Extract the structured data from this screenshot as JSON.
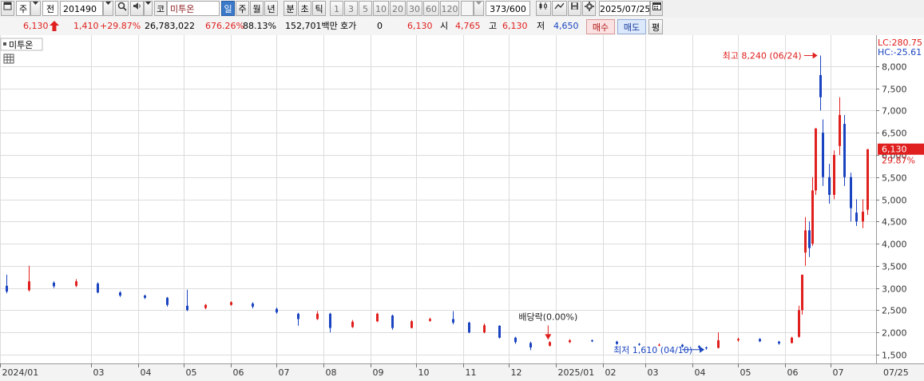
{
  "toolbar": {
    "market_label": "주",
    "prev_label": "전",
    "stock_code": "201490",
    "market_badge": "코",
    "stock_name": "미투온",
    "periods": [
      "일",
      "주",
      "월",
      "년",
      "분",
      "초",
      "틱"
    ],
    "active_period": "일",
    "intervals": [
      "1",
      "3",
      "5",
      "10",
      "20",
      "30",
      "60",
      "120"
    ],
    "count": "373/600",
    "date": "2025/07/25"
  },
  "quote": {
    "price": "6,130",
    "change": "1,410",
    "change_pct": "+29.87%",
    "volume": "26,783,022",
    "volume_ratio": "676.26%",
    "turnover": "88.13%",
    "amount": "152,701백만",
    "hoga_label": "호가",
    "hoga_value": "0",
    "hoga_price": "6,130",
    "open_label": "시",
    "open": "4,765",
    "high_label": "고",
    "high": "6,130",
    "low_label": "저",
    "low": "4,650",
    "buy_label": "매수",
    "sell_label": "매도",
    "flat_label": "평"
  },
  "colors": {
    "up": "#e0201e",
    "down": "#1a44c0",
    "grid": "#dcdcdc",
    "current_price_bg": "#e0201e"
  },
  "chart_data": {
    "type": "candlestick",
    "series_label": "미투온",
    "right_labels": {
      "lc": "LC:280.75",
      "hc": "HC:-25.61"
    },
    "current_price_label": "6,130",
    "current_pct_label": "29.87%",
    "ylim": [
      1300,
      8700
    ],
    "y_ticks": [
      1500,
      2000,
      2500,
      3000,
      3500,
      4000,
      4500,
      5000,
      5500,
      6000,
      6500,
      7000,
      7500,
      8000
    ],
    "y_tick_labels": [
      "1,500",
      "2,000",
      "2,500",
      "3,000",
      "3,500",
      "4,000",
      "4,500",
      "5,000",
      "5,500",
      "6,000",
      "6,500",
      "7,000",
      "7,500",
      "8,000"
    ],
    "x_range": [
      "2024-01-01",
      "2025-07-31"
    ],
    "x_ticks": [
      {
        "date": "2024-01-01",
        "label": "2024/01"
      },
      {
        "date": "2024-03-01",
        "label": "03"
      },
      {
        "date": "2024-04-01",
        "label": "04"
      },
      {
        "date": "2024-05-01",
        "label": "05"
      },
      {
        "date": "2024-06-01",
        "label": "06"
      },
      {
        "date": "2024-07-01",
        "label": "07"
      },
      {
        "date": "2024-08-01",
        "label": "08"
      },
      {
        "date": "2024-09-01",
        "label": "09"
      },
      {
        "date": "2024-10-01",
        "label": "10"
      },
      {
        "date": "2024-11-01",
        "label": "11"
      },
      {
        "date": "2024-12-01",
        "label": "12"
      },
      {
        "date": "2025-01-01",
        "label": "2025/01"
      },
      {
        "date": "2025-02-01",
        "label": "02"
      },
      {
        "date": "2025-03-01",
        "label": "03"
      },
      {
        "date": "2025-04-01",
        "label": "04"
      },
      {
        "date": "2025-05-01",
        "label": "05"
      },
      {
        "date": "2025-06-01",
        "label": "06"
      },
      {
        "date": "2025-07-01",
        "label": "07"
      }
    ],
    "last_date_label": "07/25",
    "annotations": [
      {
        "date": "2025-06-24",
        "price": 8240,
        "text": "최고 8,240 (06/24)",
        "kind": "high"
      },
      {
        "date": "2025-04-10",
        "price": 1610,
        "text": "최저 1,610 (04/10)",
        "kind": "low"
      },
      {
        "date": "2024-12-27",
        "price": 1780,
        "text": "배당락(0.00%)",
        "kind": "dividend"
      }
    ],
    "candles": [
      {
        "date": "2024-01-05",
        "open": 3050,
        "close": 2920,
        "high": 3300,
        "low": 2880
      },
      {
        "date": "2024-01-20",
        "open": 2950,
        "close": 3150,
        "high": 3500,
        "low": 2920
      },
      {
        "date": "2024-02-05",
        "open": 3120,
        "close": 3040,
        "high": 3150,
        "low": 3000
      },
      {
        "date": "2024-02-20",
        "open": 3050,
        "close": 3150,
        "high": 3200,
        "low": 3020
      },
      {
        "date": "2024-03-05",
        "open": 3100,
        "close": 2900,
        "high": 3130,
        "low": 2880
      },
      {
        "date": "2024-03-20",
        "open": 2900,
        "close": 2830,
        "high": 2930,
        "low": 2800
      },
      {
        "date": "2024-04-05",
        "open": 2830,
        "close": 2780,
        "high": 2850,
        "low": 2750
      },
      {
        "date": "2024-04-20",
        "open": 2780,
        "close": 2620,
        "high": 2800,
        "low": 2580
      },
      {
        "date": "2024-05-03",
        "open": 2600,
        "close": 2500,
        "high": 2960,
        "low": 2480
      },
      {
        "date": "2024-05-15",
        "open": 2550,
        "close": 2620,
        "high": 2640,
        "low": 2520
      },
      {
        "date": "2024-06-01",
        "open": 2620,
        "close": 2680,
        "high": 2700,
        "low": 2600
      },
      {
        "date": "2024-06-15",
        "open": 2650,
        "close": 2580,
        "high": 2680,
        "low": 2540
      },
      {
        "date": "2024-07-01",
        "open": 2530,
        "close": 2450,
        "high": 2560,
        "low": 2420
      },
      {
        "date": "2024-07-15",
        "open": 2420,
        "close": 2300,
        "high": 2440,
        "low": 2150
      },
      {
        "date": "2024-07-28",
        "open": 2300,
        "close": 2420,
        "high": 2480,
        "low": 2280
      },
      {
        "date": "2024-08-05",
        "open": 2420,
        "close": 2100,
        "high": 2440,
        "low": 2000
      },
      {
        "date": "2024-08-20",
        "open": 2120,
        "close": 2240,
        "high": 2280,
        "low": 2100
      },
      {
        "date": "2024-09-05",
        "open": 2250,
        "close": 2420,
        "high": 2440,
        "low": 2230
      },
      {
        "date": "2024-09-15",
        "open": 2380,
        "close": 2100,
        "high": 2400,
        "low": 2060
      },
      {
        "date": "2024-09-28",
        "open": 2100,
        "close": 2250,
        "high": 2280,
        "low": 2090
      },
      {
        "date": "2024-10-10",
        "open": 2260,
        "close": 2300,
        "high": 2330,
        "low": 2240
      },
      {
        "date": "2024-10-25",
        "open": 2300,
        "close": 2220,
        "high": 2480,
        "low": 2180
      },
      {
        "date": "2024-11-05",
        "open": 2220,
        "close": 2000,
        "high": 2240,
        "low": 1980
      },
      {
        "date": "2024-11-15",
        "open": 2000,
        "close": 2160,
        "high": 2200,
        "low": 1980
      },
      {
        "date": "2024-11-25",
        "open": 2150,
        "close": 1880,
        "high": 2160,
        "low": 1860
      },
      {
        "date": "2024-12-05",
        "open": 1880,
        "close": 1780,
        "high": 1900,
        "low": 1740
      },
      {
        "date": "2024-12-15",
        "open": 1760,
        "close": 1660,
        "high": 1790,
        "low": 1600
      },
      {
        "date": "2024-12-28",
        "open": 1700,
        "close": 1780,
        "high": 1800,
        "low": 1680
      },
      {
        "date": "2025-01-10",
        "open": 1780,
        "close": 1820,
        "high": 1850,
        "low": 1760
      },
      {
        "date": "2025-01-25",
        "open": 1820,
        "close": 1800,
        "high": 1840,
        "low": 1780
      },
      {
        "date": "2025-02-10",
        "open": 1790,
        "close": 1740,
        "high": 1810,
        "low": 1720
      },
      {
        "date": "2025-02-25",
        "open": 1740,
        "close": 1720,
        "high": 1760,
        "low": 1700
      },
      {
        "date": "2025-03-10",
        "open": 1720,
        "close": 1720,
        "high": 1750,
        "low": 1690
      },
      {
        "date": "2025-03-25",
        "open": 1720,
        "close": 1680,
        "high": 1740,
        "low": 1660
      },
      {
        "date": "2025-04-05",
        "open": 1690,
        "close": 1660,
        "high": 1710,
        "low": 1630
      },
      {
        "date": "2025-04-10",
        "open": 1660,
        "close": 1640,
        "high": 1680,
        "low": 1610
      },
      {
        "date": "2025-04-18",
        "open": 1650,
        "close": 1820,
        "high": 2000,
        "low": 1640
      },
      {
        "date": "2025-05-01",
        "open": 1820,
        "close": 1850,
        "high": 1880,
        "low": 1790
      },
      {
        "date": "2025-05-15",
        "open": 1850,
        "close": 1800,
        "high": 1870,
        "low": 1780
      },
      {
        "date": "2025-05-28",
        "open": 1790,
        "close": 1750,
        "high": 1810,
        "low": 1720
      },
      {
        "date": "2025-06-05",
        "open": 1760,
        "close": 1880,
        "high": 1900,
        "low": 1750
      },
      {
        "date": "2025-06-10",
        "open": 1900,
        "close": 2500,
        "high": 2600,
        "low": 1880
      },
      {
        "date": "2025-06-12",
        "open": 2500,
        "close": 3300,
        "high": 3300,
        "low": 2400
      },
      {
        "date": "2025-06-14",
        "open": 3800,
        "close": 4300,
        "high": 4600,
        "low": 3500
      },
      {
        "date": "2025-06-17",
        "open": 4300,
        "close": 3900,
        "high": 4500,
        "low": 3700
      },
      {
        "date": "2025-06-19",
        "open": 4000,
        "close": 5200,
        "high": 5500,
        "low": 3950
      },
      {
        "date": "2025-06-21",
        "open": 5200,
        "close": 6600,
        "high": 6600,
        "low": 5100
      },
      {
        "date": "2025-06-24",
        "open": 7800,
        "close": 7300,
        "high": 8240,
        "low": 7000
      },
      {
        "date": "2025-06-26",
        "open": 6500,
        "close": 5500,
        "high": 6800,
        "low": 5300
      },
      {
        "date": "2025-06-30",
        "open": 5500,
        "close": 5100,
        "high": 5800,
        "low": 4900
      },
      {
        "date": "2025-07-03",
        "open": 5100,
        "close": 6000,
        "high": 6100,
        "low": 5000
      },
      {
        "date": "2025-07-07",
        "open": 6200,
        "close": 6900,
        "high": 7300,
        "low": 6000
      },
      {
        "date": "2025-07-10",
        "open": 6700,
        "close": 5500,
        "high": 6900,
        "low": 5300
      },
      {
        "date": "2025-07-14",
        "open": 5500,
        "close": 4800,
        "high": 5600,
        "low": 4500
      },
      {
        "date": "2025-07-18",
        "open": 4700,
        "close": 4500,
        "high": 5000,
        "low": 4400
      },
      {
        "date": "2025-07-22",
        "open": 4500,
        "close": 4720,
        "high": 5000,
        "low": 4350
      },
      {
        "date": "2025-07-25",
        "open": 4765,
        "close": 6130,
        "high": 6130,
        "low": 4650
      }
    ]
  }
}
